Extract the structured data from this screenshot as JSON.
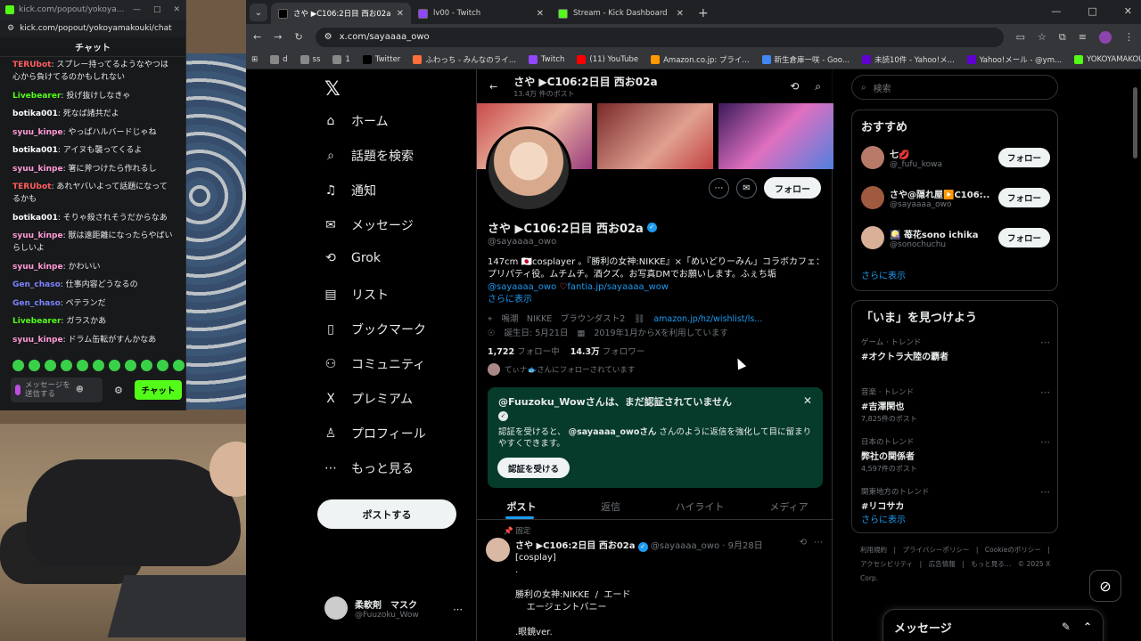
{
  "kick": {
    "url": "kick.com/popout/yokoya...",
    "address": "kick.com/popout/yokoyamakouki/chat",
    "header": "チャット",
    "messages": [
      {
        "user": "TERUbot",
        "color": "#ff5c5c",
        "text": "スプレー持ってるようなやつは心から負けてるのかもしれない"
      },
      {
        "user": "Livebearer",
        "color": "#53fc18",
        "text": "投げ抜けしなきゃ"
      },
      {
        "user": "botika001",
        "color": "#ffffff",
        "text": "死なば諸共だよ"
      },
      {
        "user": "syuu_kinpe",
        "color": "#ff9ad5",
        "text": "やっぱハルバードじゃね"
      },
      {
        "user": "botika001",
        "color": "#ffffff",
        "text": "アイヌも襲ってくるよ"
      },
      {
        "user": "syuu_kinpe",
        "color": "#ff9ad5",
        "text": "箸に斧つけたら作れるし"
      },
      {
        "user": "TERUbot",
        "color": "#ff5c5c",
        "text": "あれヤバいよって話題になってるかも"
      },
      {
        "user": "botika001",
        "color": "#ffffff",
        "text": "そりゃ殺されそうだからなあ"
      },
      {
        "user": "syuu_kinpe",
        "color": "#ff9ad5",
        "text": "獣は遠距離になったらやばいらしいよ"
      },
      {
        "user": "syuu_kinpe",
        "color": "#ff9ad5",
        "text": "かわいい"
      },
      {
        "user": "Gen_chaso",
        "color": "#7c83ff",
        "text": "仕事内容どうなるの"
      },
      {
        "user": "Gen_chaso",
        "color": "#7c83ff",
        "text": "ペテランだ"
      },
      {
        "user": "Livebearer",
        "color": "#53fc18",
        "text": "ガラスかあ"
      },
      {
        "user": "syuu_kinpe",
        "color": "#ff9ad5",
        "text": "ドラム缶転がすんかなあ"
      }
    ],
    "input_placeholder": "メッセージを送信する",
    "send_label": "チャット",
    "accent": "#53fc18"
  },
  "browser": {
    "tabs": [
      {
        "title": "さや ▶C106:2日目 西お02a (@...",
        "color": "#000000",
        "active": true
      },
      {
        "title": "lv00 - Twitch",
        "color": "#9146ff",
        "active": false
      },
      {
        "title": "Stream - Kick Dashboard",
        "color": "#53fc18",
        "active": false
      }
    ],
    "url": "x.com/sayaaaa_owo",
    "bookmarks": [
      {
        "label": "d",
        "color": "#888"
      },
      {
        "label": "ss",
        "color": "#888"
      },
      {
        "label": "1",
        "color": "#888"
      },
      {
        "label": "Twitter",
        "color": "#000"
      },
      {
        "label": "ふわっち - みんなのライ...",
        "color": "#ff6f3c"
      },
      {
        "label": "Twitch",
        "color": "#9146ff"
      },
      {
        "label": "(11) YouTube",
        "color": "#ff0000"
      },
      {
        "label": "Amazon.co.jp: プライ...",
        "color": "#ff9900"
      },
      {
        "label": "新生倉庫一咲 - Goo...",
        "color": "#4285f4"
      },
      {
        "label": "未読10件 - Yahoo!メ...",
        "color": "#6001d2"
      },
      {
        "label": "Yahoo!メール - @ym...",
        "color": "#6001d2"
      },
      {
        "label": "YOKOYAMAKOUKI...",
        "color": "#53fc18"
      }
    ]
  },
  "x": {
    "nav": [
      "ホーム",
      "話題を検索",
      "通知",
      "メッセージ",
      "Grok",
      "リスト",
      "ブックマーク",
      "コミュニティ",
      "プレミアム",
      "プロフィール",
      "もっと見る"
    ],
    "nav_icons": [
      "⌂",
      "⌕",
      "♫",
      "✉",
      "⟲",
      "▤",
      "▯",
      "⚇",
      "X",
      "♙",
      "⋯"
    ],
    "post_button": "ポストする",
    "me": {
      "name": "柔軟剤　マスク",
      "handle": "@Fuuzoku_Wow"
    },
    "profile": {
      "header_name": "さや ▶C106:2日目 西お02a",
      "header_sub": "13.4万 件のポスト",
      "name": "さや ▶C106:2日目 西お02a",
      "handle": "@sayaaaa_owo",
      "follow": "フォロー",
      "bio": "147cm 🇯🇵cosplayer 。『勝利の女神:NIKKE』×「めいどりーみん」コラボカフェ：プリパティ役。ムチムチ。酒クズ。お写真DMでお願いします。ふぇち垢",
      "bio_link1": "@sayaaaa_owo",
      "bio_link2": "fantia.jp/sayaaaa_wow",
      "more": "さらに表示",
      "loc": "鳴潮　NIKKE　ブラウンダスト2",
      "wishlist": "amazon.jp/hz/wishlist/ls...",
      "birthday": "誕生日: 5月21日",
      "joined": "2019年1月からXを利用しています",
      "following_n": "1,722",
      "following_l": "フォロー中",
      "followers_n": "14.3万",
      "followers_l": "フォロワー",
      "followed_by": "てぃナ🐟さんにフォローされています"
    },
    "verify": {
      "title": "@Fuuzoku_Wowさんは、まだ認証されていません",
      "desc1": "認証を受けると、",
      "desc_handle": "@sayaaaa_owoさん",
      "desc2": "さんのように返信を強化して目に留まりやすくできます。",
      "btn": "認証を受ける"
    },
    "ptabs": [
      "ポスト",
      "返信",
      "ハイライト",
      "メディア"
    ],
    "post": {
      "pinned": "固定",
      "name": "さや ▶C106:2日目 西お02a",
      "handle": "@sayaaaa_owo",
      "date": "9月28日",
      "body": "[cosplay]\n.\n\n勝利の女神:NIKKE  /  エード\n    エージェントバニー\n\n.眼鏡ver."
    },
    "search_placeholder": "検索",
    "suggest_title": "おすすめ",
    "suggestions": [
      {
        "name": "七💋",
        "handle": "@_fufu_kowa",
        "btn": "フォロー",
        "color": "#b97a6a"
      },
      {
        "name": "さや@隠れ屋▶️C106:...",
        "handle": "@sayaaaa_owo",
        "btn": "フォロー",
        "color": "#a05a40"
      },
      {
        "name": "🎑 苺花sono ichika",
        "handle": "@sonochuchu",
        "btn": "フォロー",
        "color": "#d8b098"
      }
    ],
    "show_more": "さらに表示",
    "trends_title": "「いま」を見つけよう",
    "trends": [
      {
        "cat": "ゲーム · トレンド",
        "name": "#オクトラ大陸の覇者",
        "posts": ""
      },
      {
        "cat": "音楽 · トレンド",
        "name": "#吉澤閑也",
        "posts": "7,825件のポスト"
      },
      {
        "cat": "日本のトレンド",
        "name": "弊社の関係者",
        "posts": "4,597件のポスト"
      },
      {
        "cat": "関東地方のトレンド",
        "name": "#リコサカ",
        "posts": ""
      }
    ],
    "footer": "利用規約　|　プライバシーポリシー　|　Cookieのポリシー　|　アクセシビリティ　|　広告情報　|　もっと見る…　© 2025 X Corp.",
    "dock": "メッセージ"
  }
}
